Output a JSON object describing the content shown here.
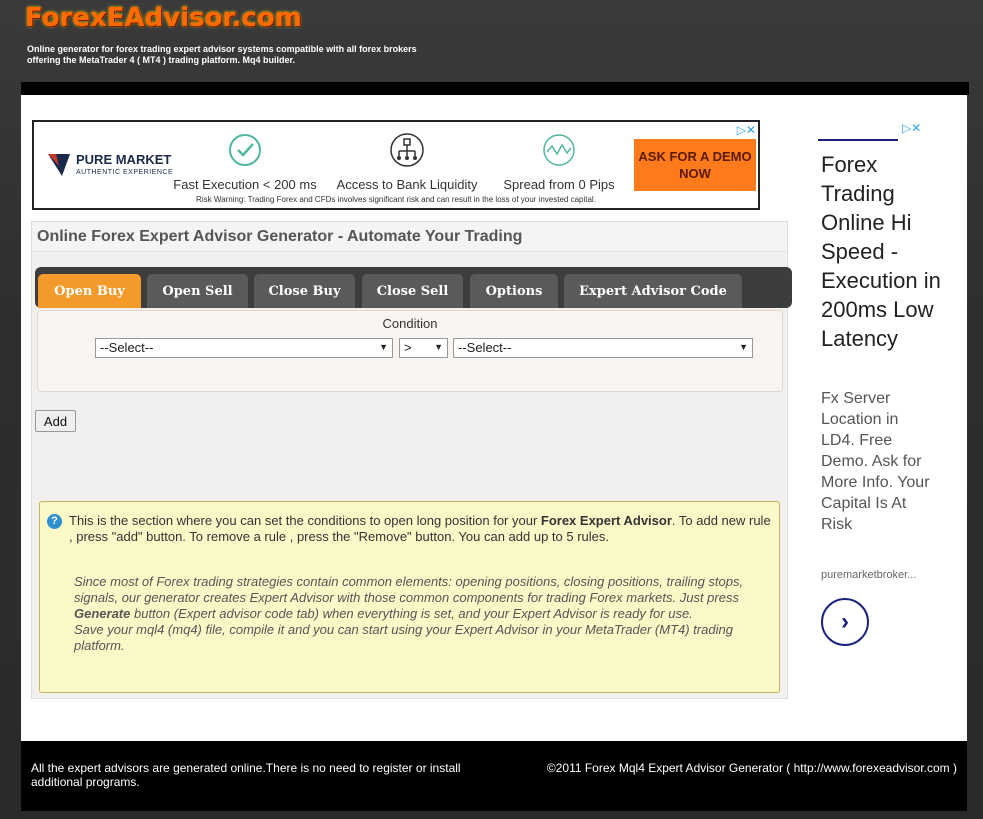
{
  "header": {
    "logo": "ForexEAdvisor.com",
    "tagline": "Online generator for forex trading expert advisor systems compatible with all forex brokers offering the MetaTrader 4 ( MT4 ) trading platform. Mq4 builder."
  },
  "ad_banner": {
    "brand_name": "PURE MARKET",
    "brand_sub": "AUTHENTIC  EXPERIENCE",
    "features": [
      {
        "label": "Fast Execution < 200 ms",
        "icon": "check-circle-icon"
      },
      {
        "label": "Access to Bank Liquidity",
        "icon": "bank-network-icon"
      },
      {
        "label": "Spread from 0 Pips",
        "icon": "wave-chart-icon"
      }
    ],
    "cta": "ASK FOR A DEMO NOW",
    "risk": "Risk Warning: Trading Forex and CFDs involves significant risk and can result in the loss of your invested capital.",
    "close_glyphs": "▷✕"
  },
  "panel": {
    "title": "Online Forex Expert Advisor Generator - Automate Your Trading",
    "tabs": [
      "Open Buy",
      "Open Sell",
      "Close Buy",
      "Close Sell",
      "Options",
      "Expert Advisor Code"
    ],
    "active_tab": "Open Buy",
    "condition_label": "Condition",
    "select_left": "--Select--",
    "operator": ">",
    "select_right": "--Select--",
    "add_button": "Add",
    "help_icon": "?",
    "help_p1_a": "This is the section where you can set the conditions to open long position for your ",
    "help_p1_bold": "Forex Expert Advisor",
    "help_p1_b": ". To add new rule , press \"add\" button. To remove a rule , press the \"Remove\" button. You can add up to 5 rules.",
    "help_p2_a": "Since most of Forex trading strategies contain common elements: opening positions, closing positions, trailing stops, signals, our generator creates Expert Advisor with those common components for trading Forex markets. Just press ",
    "help_p2_bold": "Generate",
    "help_p2_b": " button (Expert advisor code tab) when everything is set, and your Expert Advisor is ready for use.",
    "help_p2_c": "Save your mql4 (mq4) file, compile it and you can start using your Expert Advisor in your MetaTrader (MT4) trading platform."
  },
  "side_ad": {
    "headline": "Forex Trading Online Hi Speed - Execution in 200ms Low Latency",
    "body": "Fx Server Location in LD4. Free Demo. Ask for More Info. Your Capital Is At Risk",
    "url": "puremarketbroker...",
    "arrow": "›",
    "close_glyphs": "▷✕"
  },
  "footer": {
    "left": "All the expert advisors are generated online.There is no need to register or install additional programs.",
    "right": "©2011 Forex Mql4 Expert Advisor Generator ( http://www.forexeadvisor.com )"
  }
}
